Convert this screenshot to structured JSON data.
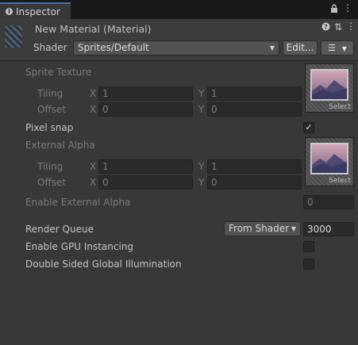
{
  "tab": {
    "icon": "info-icon",
    "label": "Inspector"
  },
  "header": {
    "title": "New Material (Material)",
    "shader_label": "Shader",
    "shader_value": "Sprites/Default",
    "edit_label": "Edit..."
  },
  "sprite_texture": {
    "label": "Sprite Texture",
    "tiling_label": "Tiling",
    "offset_label": "Offset",
    "tiling": {
      "x": "1",
      "y": "1"
    },
    "offset": {
      "x": "0",
      "y": "0"
    },
    "select_label": "Select"
  },
  "pixel_snap": {
    "label": "Pixel snap",
    "checked": true,
    "check_glyph": "✓"
  },
  "external_alpha": {
    "label": "External Alpha",
    "tiling_label": "Tiling",
    "offset_label": "Offset",
    "tiling": {
      "x": "1",
      "y": "1"
    },
    "offset": {
      "x": "0",
      "y": "0"
    },
    "select_label": "Select"
  },
  "enable_external_alpha": {
    "label": "Enable External Alpha",
    "value": "0"
  },
  "render_queue": {
    "label": "Render Queue",
    "mode": "From Shader",
    "value": "3000"
  },
  "gpu_instancing": {
    "label": "Enable GPU Instancing",
    "checked": false
  },
  "double_sided_gi": {
    "label": "Double Sided Global Illumination",
    "checked": false
  },
  "axis": {
    "x": "X",
    "y": "Y"
  }
}
